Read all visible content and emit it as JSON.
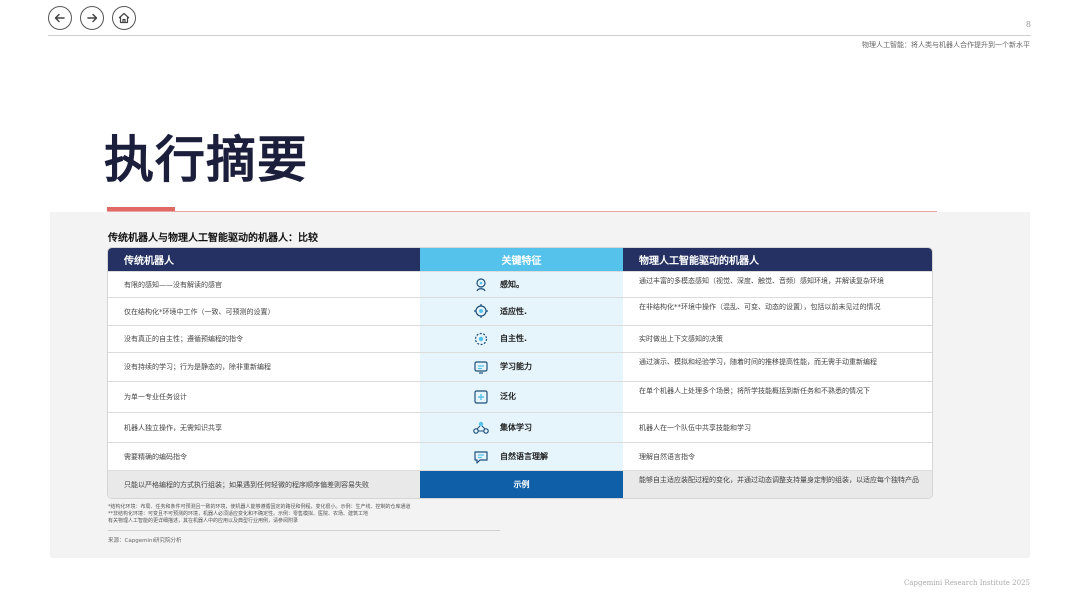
{
  "header": {
    "page_number": "8",
    "subtitle": "物理人工智能：将人类与机器人合作提升到一个新水平"
  },
  "title": "执行摘要",
  "section_title": "传统机器人与物理人工智能驱动的机器人：比较",
  "table": {
    "headers": [
      "传统机器人",
      "关键特征",
      "物理人工智能驱动的机器人"
    ],
    "rows": [
      {
        "left": "有限的感知——没有解读的感官",
        "feature": "感知。",
        "icon": "senses-icon",
        "right": "通过丰富的多模态感知（视觉、深度、触觉、音频）感知环境，并解读复杂环境"
      },
      {
        "left": "仅在结构化*环境中工作（一致、可预测的设置）",
        "feature": "适应性.",
        "icon": "adaptability-icon",
        "right": "在非结构化**环境中操作（混乱、可变、动态的设置），包括以前未见过的情况"
      },
      {
        "left": "没有真正的自主性；遵循预编程的指令",
        "feature": "自主性.",
        "icon": "autonomy-icon",
        "right": "实时做出上下文感知的决策"
      },
      {
        "left": "没有持续的学习；行为是静态的，除非重新编程",
        "feature": "学习能力",
        "icon": "learning-icon",
        "right": "通过演示、模拟和经验学习，随着时间的推移提高性能，而无需手动重新编程"
      },
      {
        "left": "为单一专业任务设计",
        "feature": "泛化",
        "icon": "generalization-icon",
        "right": "在单个机器人上处理多个场景；将所学技能概括到新任务和不熟悉的情况下"
      },
      {
        "left": "机器人独立操作，无需知识共享",
        "feature": "集体学习",
        "icon": "collective-learning-icon",
        "right": "机器人在一个队伍中共享技能和学习"
      },
      {
        "left": "需要精确的编码指令",
        "feature": "自然语言理解",
        "icon": "language-icon",
        "right": "理解自然语言指令"
      }
    ],
    "example_row": {
      "left": "只能以严格编程的方式执行组装；如果遇到任何轻微的程序顺序偏差则容易失败",
      "feature": "示例",
      "right": "能够自主适应装配过程的变化，并通过动态调整支持量身定制的组装，以适应每个独特产品"
    }
  },
  "footnotes": [
    "*结构化环境：布局、任务和条件可预测且一致的环境，使机器人能够遵循固定的路径和例程，变化很小。示例：生产线、控制的仓库通道",
    "**非结构化环境：可变且不可预测的环境，机器人必须适应变化和不确定性。示例：零售模拟、医院、农场、建筑工地",
    "有关物理人工智能的更详细描述，其在机器人中的应用以及典型行业用例，请参阅附录"
  ],
  "source": "来源：Capgemini研究院分析",
  "copyright": "Capgemini Research Institute 2025"
}
